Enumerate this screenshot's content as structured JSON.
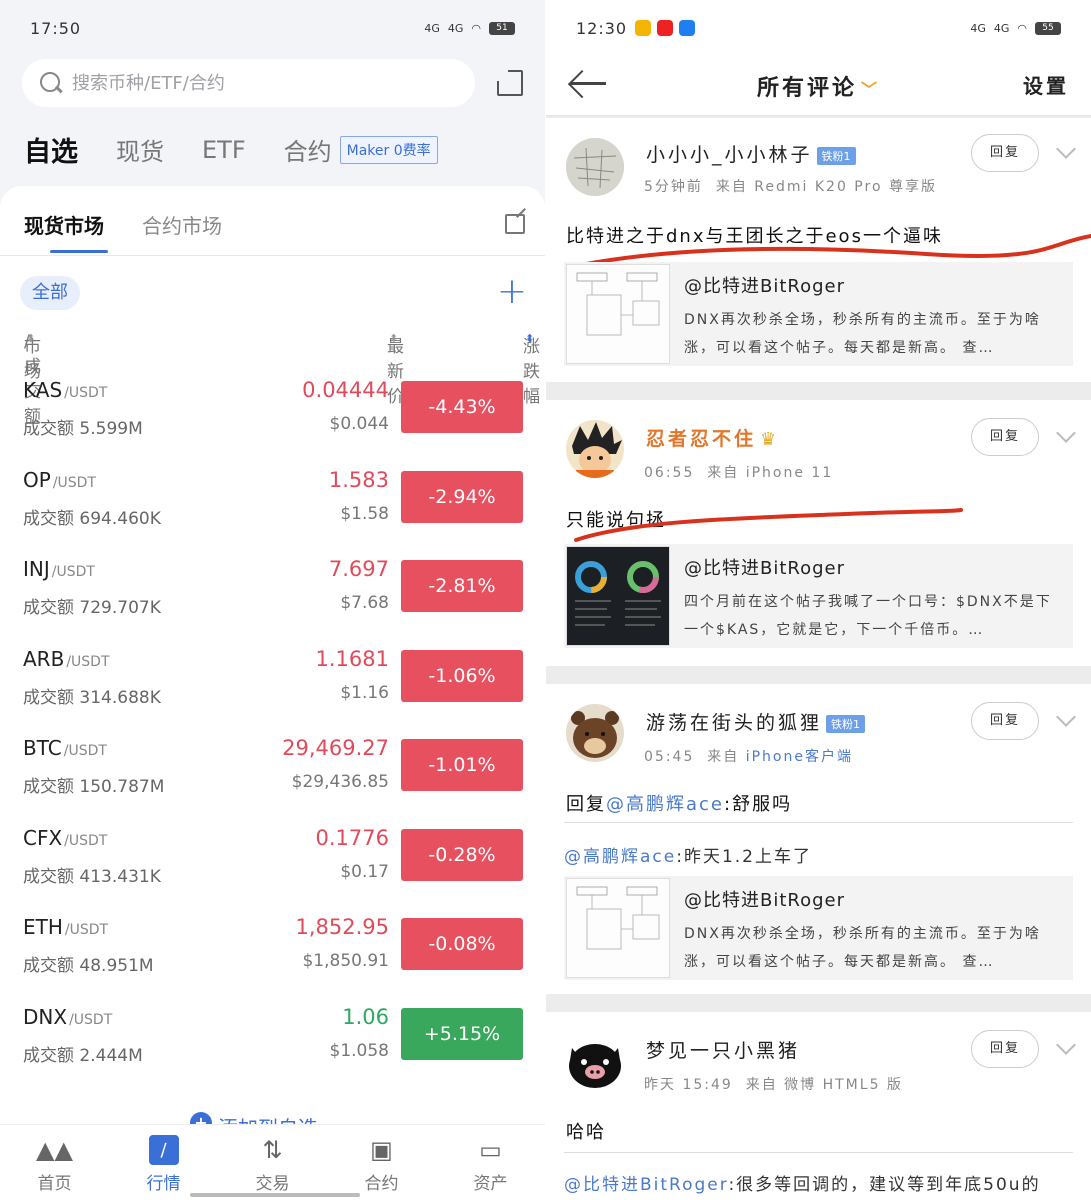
{
  "left": {
    "status": {
      "time": "17:50",
      "signal1": "4G",
      "signal2": "4G",
      "battery": "51"
    },
    "search": {
      "placeholder": "搜索币种/ETF/合约"
    },
    "top_tabs": [
      "自选",
      "现货",
      "ETF",
      "合约"
    ],
    "maker_badge": "Maker 0费率",
    "sub_tabs": [
      "现货市场",
      "合约市场"
    ],
    "filter_chip": "全部",
    "columns": {
      "market": "市场",
      "volume": "/ 成交额",
      "price": "最新价",
      "change": "涨跌幅"
    },
    "rows": [
      {
        "base": "KAS",
        "quote": "/USDT",
        "volume": "成交额 5.599M",
        "price": "0.04444",
        "usd": "$0.044",
        "change": "-4.43%",
        "up": false
      },
      {
        "base": "OP",
        "quote": "/USDT",
        "volume": "成交额 694.460K",
        "price": "1.583",
        "usd": "$1.58",
        "change": "-2.94%",
        "up": false
      },
      {
        "base": "INJ",
        "quote": "/USDT",
        "volume": "成交额 729.707K",
        "price": "7.697",
        "usd": "$7.68",
        "change": "-2.81%",
        "up": false
      },
      {
        "base": "ARB",
        "quote": "/USDT",
        "volume": "成交额 314.688K",
        "price": "1.1681",
        "usd": "$1.16",
        "change": "-1.06%",
        "up": false
      },
      {
        "base": "BTC",
        "quote": "/USDT",
        "volume": "成交额 150.787M",
        "price": "29,469.27",
        "usd": "$29,436.85",
        "change": "-1.01%",
        "up": false
      },
      {
        "base": "CFX",
        "quote": "/USDT",
        "volume": "成交额 413.431K",
        "price": "0.1776",
        "usd": "$0.17",
        "change": "-0.28%",
        "up": false
      },
      {
        "base": "ETH",
        "quote": "/USDT",
        "volume": "成交额 48.951M",
        "price": "1,852.95",
        "usd": "$1,850.91",
        "change": "-0.08%",
        "up": false
      },
      {
        "base": "DNX",
        "quote": "/USDT",
        "volume": "成交额 2.444M",
        "price": "1.06",
        "usd": "$1.058",
        "change": "+5.15%",
        "up": true
      }
    ],
    "add_favorite": "添加到自选",
    "nav": [
      "首页",
      "行情",
      "交易",
      "合约",
      "资产"
    ],
    "colors": {
      "accent": "#3b6fd8",
      "down": "#e7505f",
      "up": "#3aa85c"
    }
  },
  "right": {
    "status": {
      "time": "12:30",
      "signal1": "4G",
      "signal2": "4G",
      "battery": "55"
    },
    "header": {
      "title": "所有评论",
      "settings": "设置"
    },
    "reply_label": "回复",
    "posts": [
      {
        "user": "小小小_小小林子",
        "fan_badge": "铁粉1",
        "meta_time": "5分钟前",
        "meta_from": "来自",
        "meta_device": "Redmi K20 Pro 尊享版",
        "text": "比特进之于dnx与王团长之于eos一个逼味",
        "quote_title": "@比特进BitRoger",
        "quote_body": "DNX再次秒杀全场，秒杀所有的主流币。至于为啥涨，可以看这个帖子。每天都是新高。 查…"
      },
      {
        "user": "忍者忍不住",
        "meta_time": "06:55",
        "meta_from": "来自",
        "meta_device": "iPhone 11",
        "text": "只能说句拯",
        "quote_title": "@比特进BitRoger",
        "quote_body": "四个月前在这个帖子我喊了一个口号：$DNX不是下一个$KAS，它就是它，下一个千倍币。…"
      },
      {
        "user": "游荡在街头的狐狸",
        "fan_badge": "铁粉1",
        "meta_time": "05:45",
        "meta_from": "来自",
        "meta_device": "iPhone客户端",
        "text_prefix": "回复",
        "text_mention": "@高鹏辉ace",
        "text_suffix": ":舒服吗",
        "reply_mention": "@高鹏辉ace",
        "reply_text": ":昨天1.2上车了",
        "quote_title": "@比特进BitRoger",
        "quote_body": "DNX再次秒杀全场，秒杀所有的主流币。至于为啥涨，可以看这个帖子。每天都是新高。 查…"
      },
      {
        "user": "梦见一只小黑猪",
        "meta_time": "昨天 15:49",
        "meta_from": "来自",
        "meta_device": "微博 HTML5 版",
        "text": "哈哈",
        "reply_mention": "@比特进BitRoger",
        "reply_text": ":很多等回调的，建议等到年底50u的"
      }
    ]
  }
}
